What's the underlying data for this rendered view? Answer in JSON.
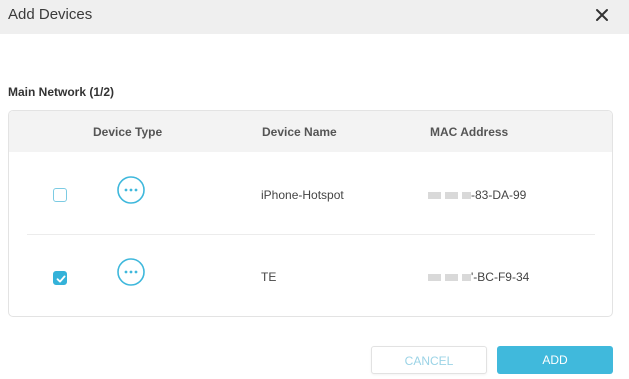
{
  "dialog": {
    "title": "Add Devices",
    "close_icon": "close-icon"
  },
  "section": {
    "title": "Main Network (1/2)"
  },
  "table": {
    "columns": [
      "",
      "Device Type",
      "Device Name",
      "MAC Address"
    ],
    "rows": [
      {
        "selected": false,
        "device_type_icon": "more-dots-icon",
        "device_name": "iPhone-Hotspot",
        "mac_visible": "-83-DA-99"
      },
      {
        "selected": true,
        "device_type_icon": "more-dots-icon",
        "device_name": "TE",
        "mac_visible": "'-BC-F9-34"
      }
    ]
  },
  "buttons": {
    "cancel": "CANCEL",
    "add": "ADD"
  },
  "colors": {
    "accent": "#40b9dc",
    "title_bar": "#efefef",
    "header_bg": "#f3f3f3"
  }
}
